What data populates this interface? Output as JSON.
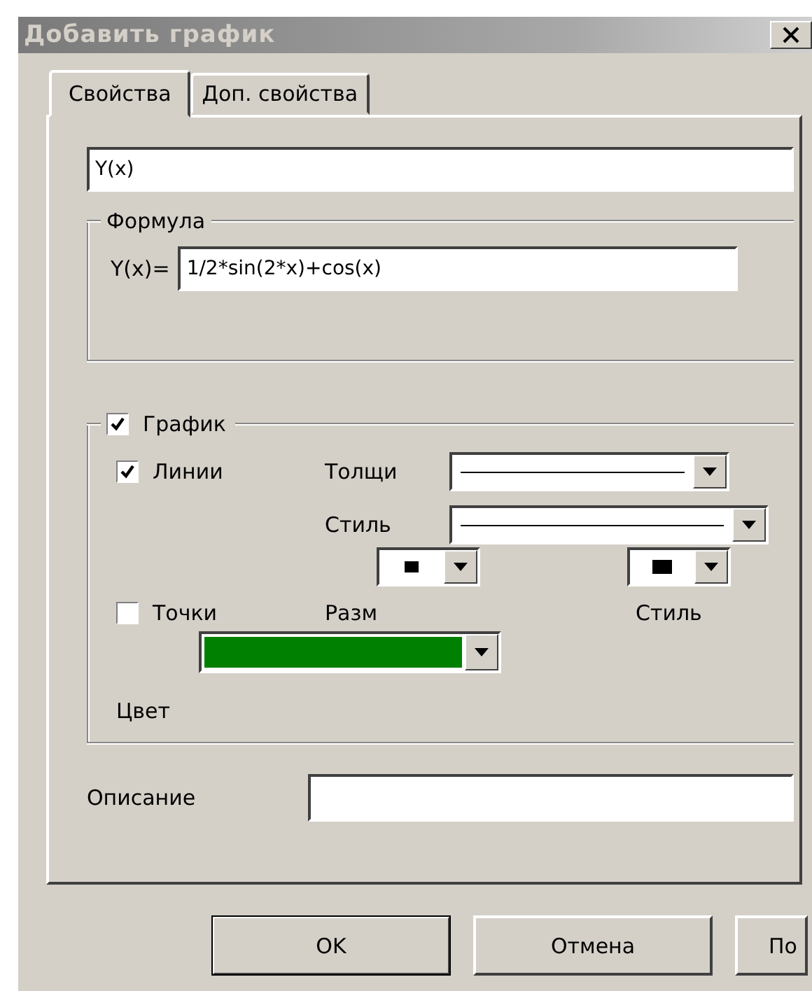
{
  "window": {
    "title": "Добавить график"
  },
  "tabs": [
    {
      "label": "Свойства",
      "selected": true
    },
    {
      "label": "Доп. свойства",
      "selected": false
    }
  ],
  "name_field": {
    "value": "Y(x)"
  },
  "formula": {
    "title": "Формула",
    "label": "Y(x)=",
    "value": "1/2*sin(2*x)+cos(x)"
  },
  "graph": {
    "label": "График",
    "checked": true,
    "lines": {
      "label": "Линии",
      "checked": true,
      "thickness_label": "Толщи",
      "style_label": "Стиль"
    },
    "points": {
      "label": "Точки",
      "checked": false,
      "size_label": "Разм",
      "style_label": "Стиль"
    },
    "color": "#008000",
    "color_label": "Цвет"
  },
  "description": {
    "label": "Описание"
  },
  "buttons": [
    "OK",
    "Отмена",
    "По"
  ]
}
